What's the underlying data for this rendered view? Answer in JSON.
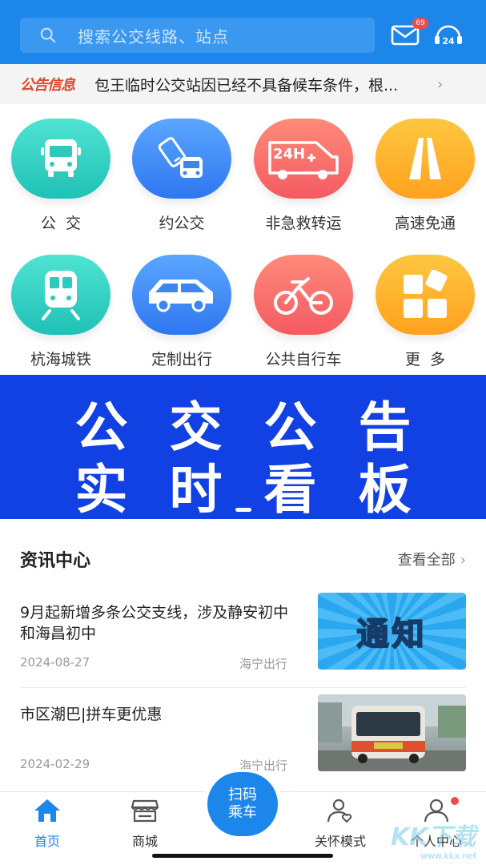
{
  "header": {
    "search_placeholder": "搜索公交线路、站点",
    "mail_badge": "69",
    "icons": {
      "search": "search-icon",
      "mail": "mail-icon",
      "service": "headset-24-icon"
    }
  },
  "notice": {
    "tag": "公告信息",
    "text": "包王临时公交站因已经不具备候车条件，根...",
    "arrow": "›"
  },
  "services": [
    {
      "label": "公  交",
      "icon": "bus-icon"
    },
    {
      "label": "约公交",
      "icon": "phone-bus-icon"
    },
    {
      "label": "非急救转运",
      "icon": "ambulance-24h-icon"
    },
    {
      "label": "高速免通",
      "icon": "highway-icon"
    },
    {
      "label": "杭海城铁",
      "icon": "train-icon"
    },
    {
      "label": "定制出行",
      "icon": "van-icon"
    },
    {
      "label": "公共自行车",
      "icon": "bicycle-icon"
    },
    {
      "label": "更  多",
      "icon": "more-grid-icon"
    }
  ],
  "banner": {
    "line1": "公交公告",
    "line2": "实时看板"
  },
  "news": {
    "title": "资讯中心",
    "more": "查看全部",
    "more_arrow": "›",
    "items": [
      {
        "title": "9月起新增多条公交支线，涉及静安初中和海昌初中",
        "date": "2024-08-27",
        "source": "海宁出行",
        "thumb_text": "通知"
      },
      {
        "title": "市区潮巴|拼车更优惠",
        "date": "2024-02-29",
        "source": "海宁出行",
        "thumb_text": ""
      }
    ]
  },
  "tabbar": {
    "home": "首页",
    "mall": "商城",
    "scan_line1": "扫码",
    "scan_line2": "乘车",
    "care": "关怀模式",
    "me": "个人中心"
  },
  "watermark": {
    "main": "KK下载",
    "sub": "www.kkx.net"
  },
  "colors": {
    "primary": "#1d86ea",
    "banner": "#1241e3",
    "notice_tag": "#e2462b",
    "badge": "#f14b4b"
  }
}
